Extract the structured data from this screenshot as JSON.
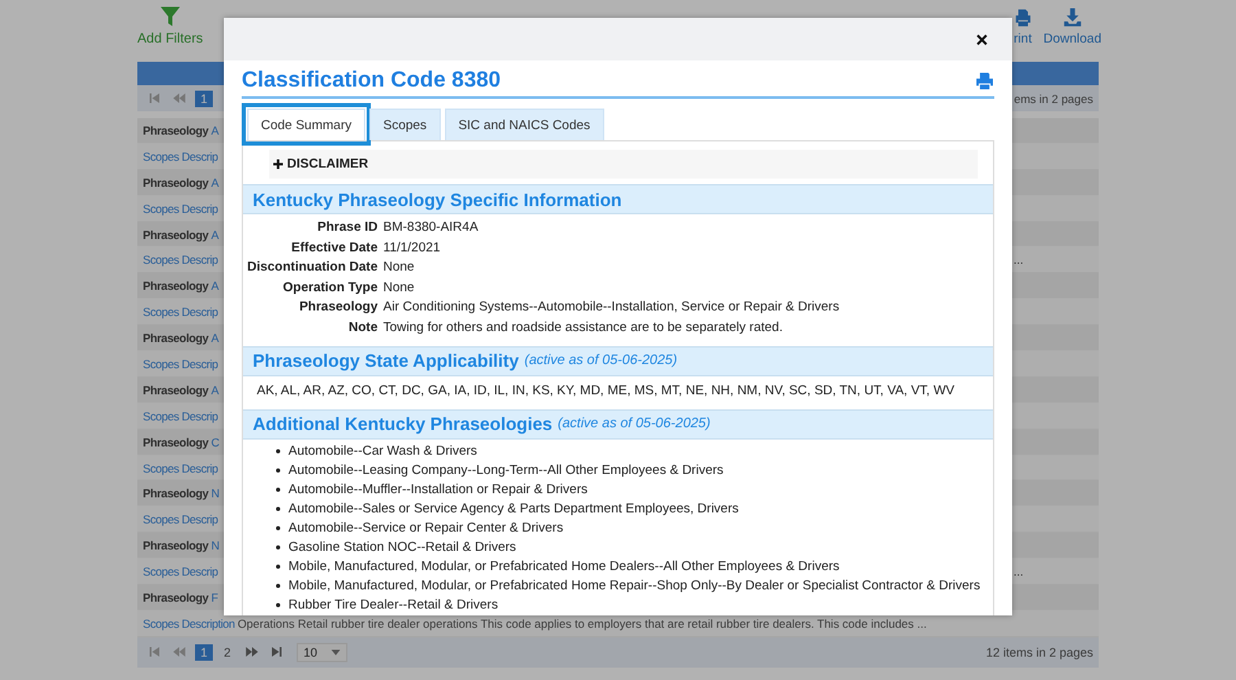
{
  "toolbar": {
    "add_filters": "Add Filters",
    "print": "rint",
    "download": "Download"
  },
  "top_pager": {
    "pages": [
      {
        "label": "1",
        "selected": true
      }
    ],
    "summary": "ems in 2 pages"
  },
  "rows": [
    {
      "kind": "phraseology",
      "label": "Phraseology",
      "value": "A"
    },
    {
      "kind": "scopes",
      "label": "Scopes Descrip"
    },
    {
      "kind": "phraseology",
      "label": "Phraseology",
      "value": "A"
    },
    {
      "kind": "scopes",
      "label": "Scopes Descrip"
    },
    {
      "kind": "phraseology",
      "label": "Phraseology",
      "value": "A"
    },
    {
      "kind": "scopes",
      "label": "Scopes Descrip",
      "tail": "..."
    },
    {
      "kind": "phraseology",
      "label": "Phraseology",
      "value": "A"
    },
    {
      "kind": "scopes",
      "label": "Scopes Descrip"
    },
    {
      "kind": "phraseology",
      "label": "Phraseology",
      "value": "A"
    },
    {
      "kind": "scopes",
      "label": "Scopes Descrip"
    },
    {
      "kind": "phraseology",
      "label": "Phraseology",
      "value": "A"
    },
    {
      "kind": "scopes",
      "label": "Scopes Descrip"
    },
    {
      "kind": "phraseology",
      "label": "Phraseology",
      "value": "C"
    },
    {
      "kind": "scopes",
      "label": "Scopes Descrip"
    },
    {
      "kind": "phraseology",
      "label": "Phraseology",
      "value": "N"
    },
    {
      "kind": "scopes",
      "label": "Scopes Descrip"
    },
    {
      "kind": "phraseology",
      "label": "Phraseology",
      "value": "N"
    },
    {
      "kind": "scopes",
      "label": "Scopes Descrip",
      "tail": "..."
    },
    {
      "kind": "phraseology",
      "label": "Phraseology",
      "value": "F"
    },
    {
      "kind": "scopes",
      "label": "Scopes Description",
      "text": "Operations Retail rubber tire dealer operations This code applies to employers that are retail rubber tire dealers. This code includes ..."
    }
  ],
  "bottom_pager": {
    "pages": [
      {
        "label": "1",
        "selected": true
      },
      {
        "label": "2",
        "selected": false
      }
    ],
    "page_size": "10",
    "summary": "12 items in 2 pages"
  },
  "modal": {
    "title": "Classification Code 8380",
    "tabs": [
      {
        "label": "Code Summary",
        "selected": true
      },
      {
        "label": "Scopes",
        "selected": false
      },
      {
        "label": "SIC and NAICS Codes",
        "selected": false
      }
    ],
    "disclaimer": {
      "label": "DISCLAIMER",
      "expanded": false
    },
    "sections": [
      {
        "kind": "fields",
        "title": "Kentucky Phraseology Specific Information",
        "fields": [
          {
            "label": "Phrase ID",
            "value": "BM-8380-AIR4A"
          },
          {
            "label": "Effective Date",
            "value": "11/1/2021"
          },
          {
            "label": "Discontinuation Date",
            "value": "None"
          },
          {
            "label": "Operation Type",
            "value": "None"
          },
          {
            "label": "Phraseology",
            "value": "Air Conditioning Systems--Automobile--Installation, Service or Repair & Drivers"
          },
          {
            "label": "Note",
            "value": "Towing for others and roadside assistance are to be separately rated."
          }
        ]
      },
      {
        "kind": "text",
        "title": "Phraseology State Applicability",
        "note": "(active as of 05-06-2025)",
        "text": "AK, AL, AR, AZ, CO, CT, DC, GA, IA, ID, IL, IN, KS, KY, MD, ME, MS, MT, NE, NH, NM, NV, SC, SD, TN, UT, VA, VT, WV"
      },
      {
        "kind": "list",
        "title": "Additional Kentucky Phraseologies",
        "note": "(active as of 05-06-2025)",
        "items": [
          "Automobile--Car Wash & Drivers",
          "Automobile--Leasing Company--Long-Term--All Other Employees & Drivers",
          "Automobile--Muffler--Installation or Repair & Drivers",
          "Automobile--Sales or Service Agency & Parts Department Employees, Drivers",
          "Automobile--Service or Repair Center & Drivers",
          "Gasoline Station NOC--Retail & Drivers",
          "Mobile, Manufactured, Modular, or Prefabricated Home Dealers--All Other Employees & Drivers",
          "Mobile, Manufactured, Modular, or Prefabricated Home Repair--Shop Only--By Dealer or Specialist Contractor & Drivers",
          "Rubber Tire Dealer--Retail & Drivers"
        ]
      }
    ]
  }
}
